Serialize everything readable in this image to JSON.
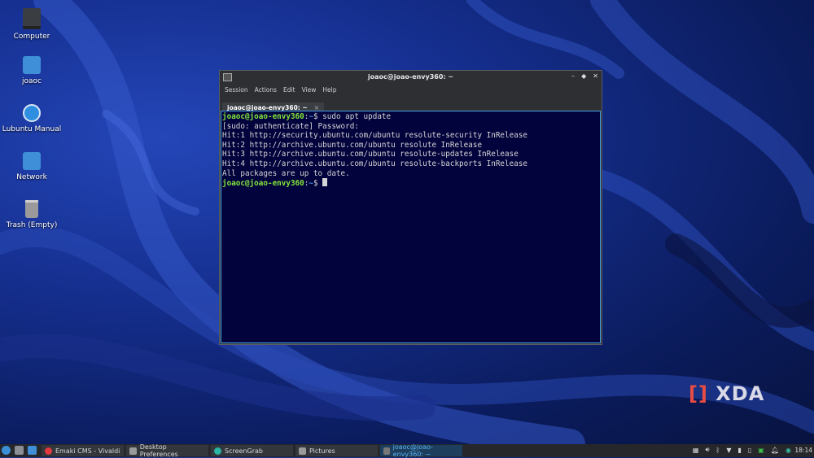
{
  "desktop": {
    "icons": [
      {
        "label": "Computer"
      },
      {
        "label": "joaoc"
      },
      {
        "label": "Lubuntu Manual"
      },
      {
        "label": "Network"
      },
      {
        "label": "Trash (Empty)"
      }
    ]
  },
  "terminal": {
    "title": "joaoc@joao-envy360: ~",
    "menu": [
      "Session",
      "Actions",
      "Edit",
      "View",
      "Help"
    ],
    "tab_label": "joaoc@joao-envy360: ~",
    "tab_close": "×",
    "prompt_user": "joaoc@joao-envy360",
    "lines": {
      "cmd_sep": ":",
      "cmd_path": "~",
      "cmd_suffix": "$ sudo apt update",
      "l1": "[sudo: authenticate] Password:",
      "l2": "Hit:1 http://security.ubuntu.com/ubuntu resolute-security InRelease",
      "l3": "Hit:2 http://archive.ubuntu.com/ubuntu resolute InRelease",
      "l4": "Hit:3 http://archive.ubuntu.com/ubuntu resolute-updates InRelease",
      "l5": "Hit:4 http://archive.ubuntu.com/ubuntu resolute-backports InRelease",
      "l6": "All packages are up to date.",
      "prompt2_suffix": "$ "
    }
  },
  "watermark": {
    "text": "XDA",
    "bracket": "[]"
  },
  "taskbar": {
    "tasks": [
      {
        "label": "Emaki CMS - Vivaldi",
        "color": "#e0393e"
      },
      {
        "label": "Desktop Preferences",
        "color": "#9a9a9a"
      },
      {
        "label": "ScreenGrab",
        "color": "#2bb3a3"
      },
      {
        "label": "Pictures",
        "color": "#9a9a9a"
      },
      {
        "label": "joaoc@joao-envy360: ~",
        "color": "#777777"
      }
    ],
    "clock": "18:14"
  },
  "colors": {
    "accent": "#4ea3e0",
    "prompt": "#83e63a",
    "path": "#4b8fe8"
  }
}
